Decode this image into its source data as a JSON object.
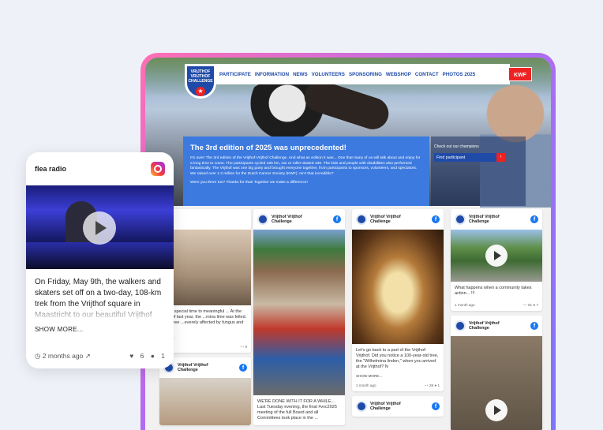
{
  "site": {
    "logo_lines": [
      "VRIJTHOF",
      "VRIJTHOF",
      "CHALLENGE"
    ],
    "nav": [
      "PARTICIPATE",
      "INFORMATION",
      "NEWS",
      "VOLUNTEERS",
      "SPONSORING",
      "WEBSHOP",
      "CONTACT",
      "PHOTOS 2025"
    ],
    "partner_badge": "KWF",
    "brand_blue": "#1f4aa8",
    "accent_red": "#e22222"
  },
  "banner": {
    "title": "The 3rd edition of 2025 was unprecedented!",
    "body": "It's over! The 3rd edition of the Vrijthof-Vrijthof Challenge. And what an edition it was... One that many of us will talk about and enjoy for a long time to come. The participants cycled 165 km, ran or roller-skated 108. The kids and people with disabilities also performed fantastically. The Vrijthof was one big party and brought everyone together, from participants to sponsors, volunteers, and spectators. We raised over 1.2 million for the Dutch Cancer Society (KWF). Isn't that incredible?",
    "cta": "Were you there too? Thanks for that! Together we make a difference!"
  },
  "champions": {
    "label": "Check out our champions",
    "button": "Find participant",
    "button_icon": "arrow-right-icon"
  },
  "feed": {
    "author": "Vrijthof Vrijthof Challenge",
    "network_icon": "facebook-icon",
    "col1": [
      {
        "text": "...om special time to meaningful ... At the end of last year, the ...mina lime was felled. The tree ...everely affected by fungus and ...",
        "more": "...ore...",
        "time": "...ago",
        "likes": "9"
      }
    ],
    "col2": [
      {
        "text": "WE'RE DONE WITH IT FOR A WHILE... Last Tuesday evening, the final #vvc2025 meeting of the full Board and all Committees took place in the ..."
      }
    ],
    "col3": [
      {
        "text": "Let's go back to a part of the Vrijthof-Vrijthof. Did you notice a 100-year-old tree, the \"Wilhelmina linden,\" when you arrived at the Vrijthof? N",
        "more": "SHOW MORE...",
        "time": "1 month ago",
        "likes": "28",
        "comments": "1"
      }
    ],
    "col4": [
      {
        "text": "What happens when a community takes action... !!!",
        "time": "1 month ago",
        "likes": "51",
        "comments": "7"
      }
    ]
  },
  "instagram_card": {
    "account": "flea radio",
    "network_icon": "instagram-icon",
    "text": "On Friday, May 9th, the walkers and skaters set off on a two-day, 108-km trek from the Vrijthof square in Maastricht to our beautiful Vrijthof square in Hilversbeek ...",
    "more": "SHOW MORE...",
    "time": "2 months ago",
    "likes": "6",
    "comments": "1"
  }
}
